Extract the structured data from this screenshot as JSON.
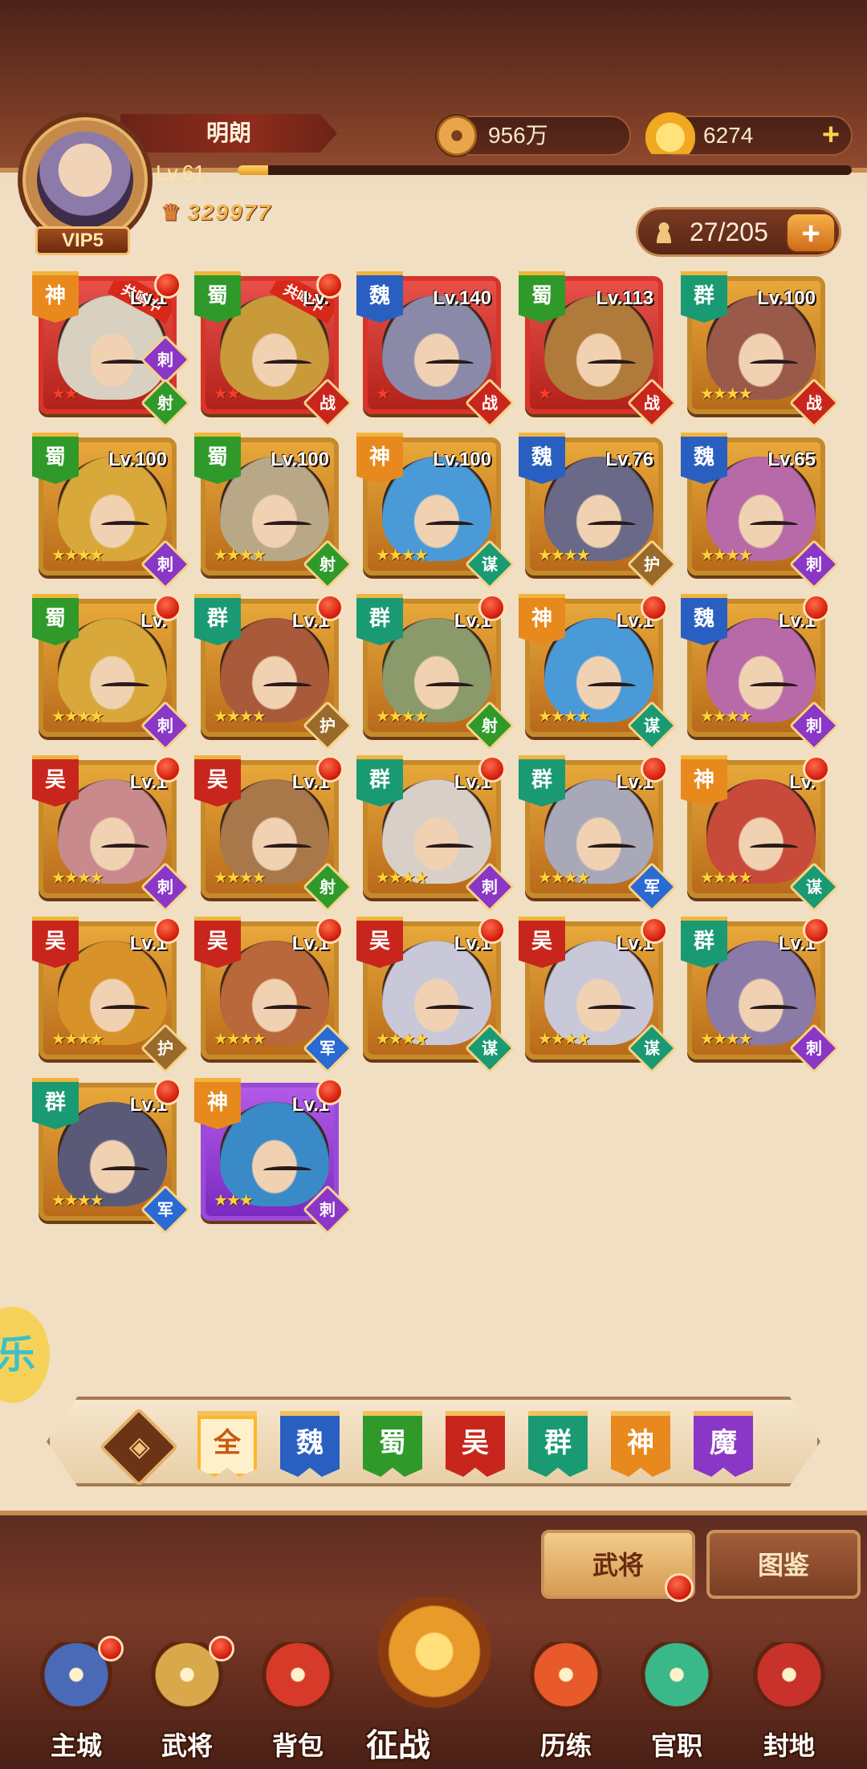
{
  "player": {
    "name": "明朗",
    "level": "Lv.61",
    "vip": "VIP5",
    "power": "329977",
    "exp_progress": 0.05
  },
  "currency": {
    "coins": "956万",
    "gold": "6274"
  },
  "roster": {
    "count": "27/205"
  },
  "colors": {
    "shen": "#e8891e",
    "shu": "#2f9a2a",
    "wei": "#2a5fc2",
    "wu": "#c8261c",
    "qun": "#1a9a72",
    "mo": "#8a36c6",
    "class_ci": "#8a36c6",
    "class_she": "#2f9a2a",
    "class_zhan": "#c8261c",
    "class_mou": "#1a9a72",
    "class_hu": "#9a6a2a",
    "class_jun": "#2a6ad2"
  },
  "heroes": [
    {
      "faction": "神",
      "lv": "Lv.1",
      "stars": "★★",
      "class": "射",
      "side": "刺",
      "resonance": "共鸣中",
      "dot": true,
      "frame": "red",
      "portrait": "#d8d0c0"
    },
    {
      "faction": "蜀",
      "lv": "Lv.",
      "stars": "★★",
      "class": "战",
      "side": "",
      "resonance": "共鸣中",
      "dot": true,
      "frame": "red",
      "portrait": "#c89a3a"
    },
    {
      "faction": "魏",
      "lv": "Lv.140",
      "stars": "★",
      "class": "战",
      "side": "",
      "resonance": "",
      "dot": false,
      "frame": "red",
      "portrait": "#8a8aa8"
    },
    {
      "faction": "蜀",
      "lv": "Lv.113",
      "stars": "★",
      "class": "战",
      "side": "",
      "resonance": "",
      "dot": false,
      "frame": "red",
      "portrait": "#b07a3a"
    },
    {
      "faction": "群",
      "lv": "Lv.100",
      "stars": "★★★★",
      "class": "战",
      "side": "",
      "resonance": "",
      "dot": false,
      "frame": "gold",
      "portrait": "#9a5a4a"
    },
    {
      "faction": "蜀",
      "lv": "Lv.100",
      "stars": "★★★★",
      "class": "刺",
      "side": "",
      "resonance": "",
      "dot": false,
      "frame": "gold",
      "portrait": "#d8a83a"
    },
    {
      "faction": "蜀",
      "lv": "Lv.100",
      "stars": "★★★★",
      "class": "射",
      "side": "",
      "resonance": "",
      "dot": false,
      "frame": "gold",
      "portrait": "#b8a888"
    },
    {
      "faction": "神",
      "lv": "Lv.100",
      "stars": "★★★★",
      "class": "谋",
      "side": "",
      "resonance": "",
      "dot": false,
      "frame": "gold",
      "portrait": "#4a9ad8"
    },
    {
      "faction": "魏",
      "lv": "Lv.76",
      "stars": "★★★★",
      "class": "护",
      "side": "",
      "resonance": "",
      "dot": false,
      "frame": "gold",
      "portrait": "#6a6a88"
    },
    {
      "faction": "魏",
      "lv": "Lv.65",
      "stars": "★★★★",
      "class": "刺",
      "side": "",
      "resonance": "",
      "dot": false,
      "frame": "gold",
      "portrait": "#b86aa8"
    },
    {
      "faction": "蜀",
      "lv": "Lv.",
      "stars": "★★★★",
      "class": "刺",
      "side": "",
      "resonance": "",
      "dot": true,
      "frame": "gold",
      "portrait": "#d8a83a"
    },
    {
      "faction": "群",
      "lv": "Lv.1",
      "stars": "★★★★",
      "class": "护",
      "side": "",
      "resonance": "",
      "dot": true,
      "frame": "gold",
      "portrait": "#a85a3a"
    },
    {
      "faction": "群",
      "lv": "Lv.1",
      "stars": "★★★★",
      "class": "射",
      "side": "",
      "resonance": "",
      "dot": true,
      "frame": "gold",
      "portrait": "#8a9a6a"
    },
    {
      "faction": "神",
      "lv": "Lv.1",
      "stars": "★★★★",
      "class": "谋",
      "side": "",
      "resonance": "",
      "dot": true,
      "frame": "gold",
      "portrait": "#4a9ad8"
    },
    {
      "faction": "魏",
      "lv": "Lv.1",
      "stars": "★★★★",
      "class": "刺",
      "side": "",
      "resonance": "",
      "dot": true,
      "frame": "gold",
      "portrait": "#b86aa8"
    },
    {
      "faction": "吴",
      "lv": "Lv.1",
      "stars": "★★★★",
      "class": "刺",
      "side": "",
      "resonance": "",
      "dot": true,
      "frame": "gold",
      "portrait": "#c88a8a"
    },
    {
      "faction": "吴",
      "lv": "Lv.1",
      "stars": "★★★★",
      "class": "射",
      "side": "",
      "resonance": "",
      "dot": true,
      "frame": "gold",
      "portrait": "#a8784a"
    },
    {
      "faction": "群",
      "lv": "Lv.1",
      "stars": "★★★★",
      "class": "刺",
      "side": "",
      "resonance": "",
      "dot": true,
      "frame": "gold",
      "portrait": "#d8d0c8"
    },
    {
      "faction": "群",
      "lv": "Lv.1",
      "stars": "★★★★",
      "class": "军",
      "side": "",
      "resonance": "",
      "dot": true,
      "frame": "gold",
      "portrait": "#a8a8b8"
    },
    {
      "faction": "神",
      "lv": "Lv.",
      "stars": "★★★★",
      "class": "谋",
      "side": "",
      "resonance": "",
      "dot": true,
      "frame": "gold",
      "portrait": "#c84a3a"
    },
    {
      "faction": "吴",
      "lv": "Lv.1",
      "stars": "★★★★",
      "class": "护",
      "side": "",
      "resonance": "",
      "dot": true,
      "frame": "gold",
      "portrait": "#d8922a"
    },
    {
      "faction": "吴",
      "lv": "Lv.1",
      "stars": "★★★★",
      "class": "军",
      "side": "",
      "resonance": "",
      "dot": true,
      "frame": "gold",
      "portrait": "#b8683a"
    },
    {
      "faction": "吴",
      "lv": "Lv.1",
      "stars": "★★★★",
      "class": "谋",
      "side": "",
      "resonance": "",
      "dot": true,
      "frame": "gold",
      "portrait": "#c8c8d8"
    },
    {
      "faction": "吴",
      "lv": "Lv.1",
      "stars": "★★★★",
      "class": "谋",
      "side": "",
      "resonance": "",
      "dot": true,
      "frame": "gold",
      "portrait": "#c8c8d8"
    },
    {
      "faction": "群",
      "lv": "Lv.1",
      "stars": "★★★★",
      "class": "刺",
      "side": "",
      "resonance": "",
      "dot": true,
      "frame": "gold",
      "portrait": "#8a7aa8"
    },
    {
      "faction": "群",
      "lv": "Lv.1",
      "stars": "★★★★",
      "class": "军",
      "side": "",
      "resonance": "",
      "dot": true,
      "frame": "gold",
      "portrait": "#5a5a78"
    },
    {
      "faction": "神",
      "lv": "Lv.1",
      "stars": "★★★",
      "class": "刺",
      "side": "",
      "resonance": "",
      "dot": true,
      "frame": "purple",
      "portrait": "#3a8ac8"
    }
  ],
  "filters": {
    "sort_icon": "sort-diamond-icon",
    "items": [
      {
        "label": "全",
        "color": "#e88a2a",
        "selected": true
      },
      {
        "label": "魏",
        "color": "#2a5fc2",
        "selected": false
      },
      {
        "label": "蜀",
        "color": "#2f9a2a",
        "selected": false
      },
      {
        "label": "吴",
        "color": "#c8261c",
        "selected": false
      },
      {
        "label": "群",
        "color": "#1a9a72",
        "selected": false
      },
      {
        "label": "神",
        "color": "#e8891e",
        "selected": false
      },
      {
        "label": "魔",
        "color": "#8a36c6",
        "selected": false
      }
    ]
  },
  "side_bubble": "乐",
  "sub_tabs": {
    "heroes": "武将",
    "codex": "图鉴"
  },
  "nav": [
    {
      "label": "主城",
      "icon": "palace-icon",
      "dot": true,
      "color": "#4a6ab8"
    },
    {
      "label": "武将",
      "icon": "hero-helmet-icon",
      "dot": true,
      "color": "#d8a84a"
    },
    {
      "label": "背包",
      "icon": "bag-icon",
      "dot": false,
      "color": "#d83a2a"
    },
    {
      "label": "征战",
      "icon": "battle-emblem-icon",
      "dot": false,
      "color": "#e89a2a"
    },
    {
      "label": "历练",
      "icon": "scroll-icon",
      "dot": false,
      "color": "#e85a2a"
    },
    {
      "label": "官职",
      "icon": "jade-seal-icon",
      "dot": false,
      "color": "#3ab88a"
    },
    {
      "label": "封地",
      "icon": "fief-gate-icon",
      "dot": false,
      "color": "#c8322a"
    }
  ]
}
